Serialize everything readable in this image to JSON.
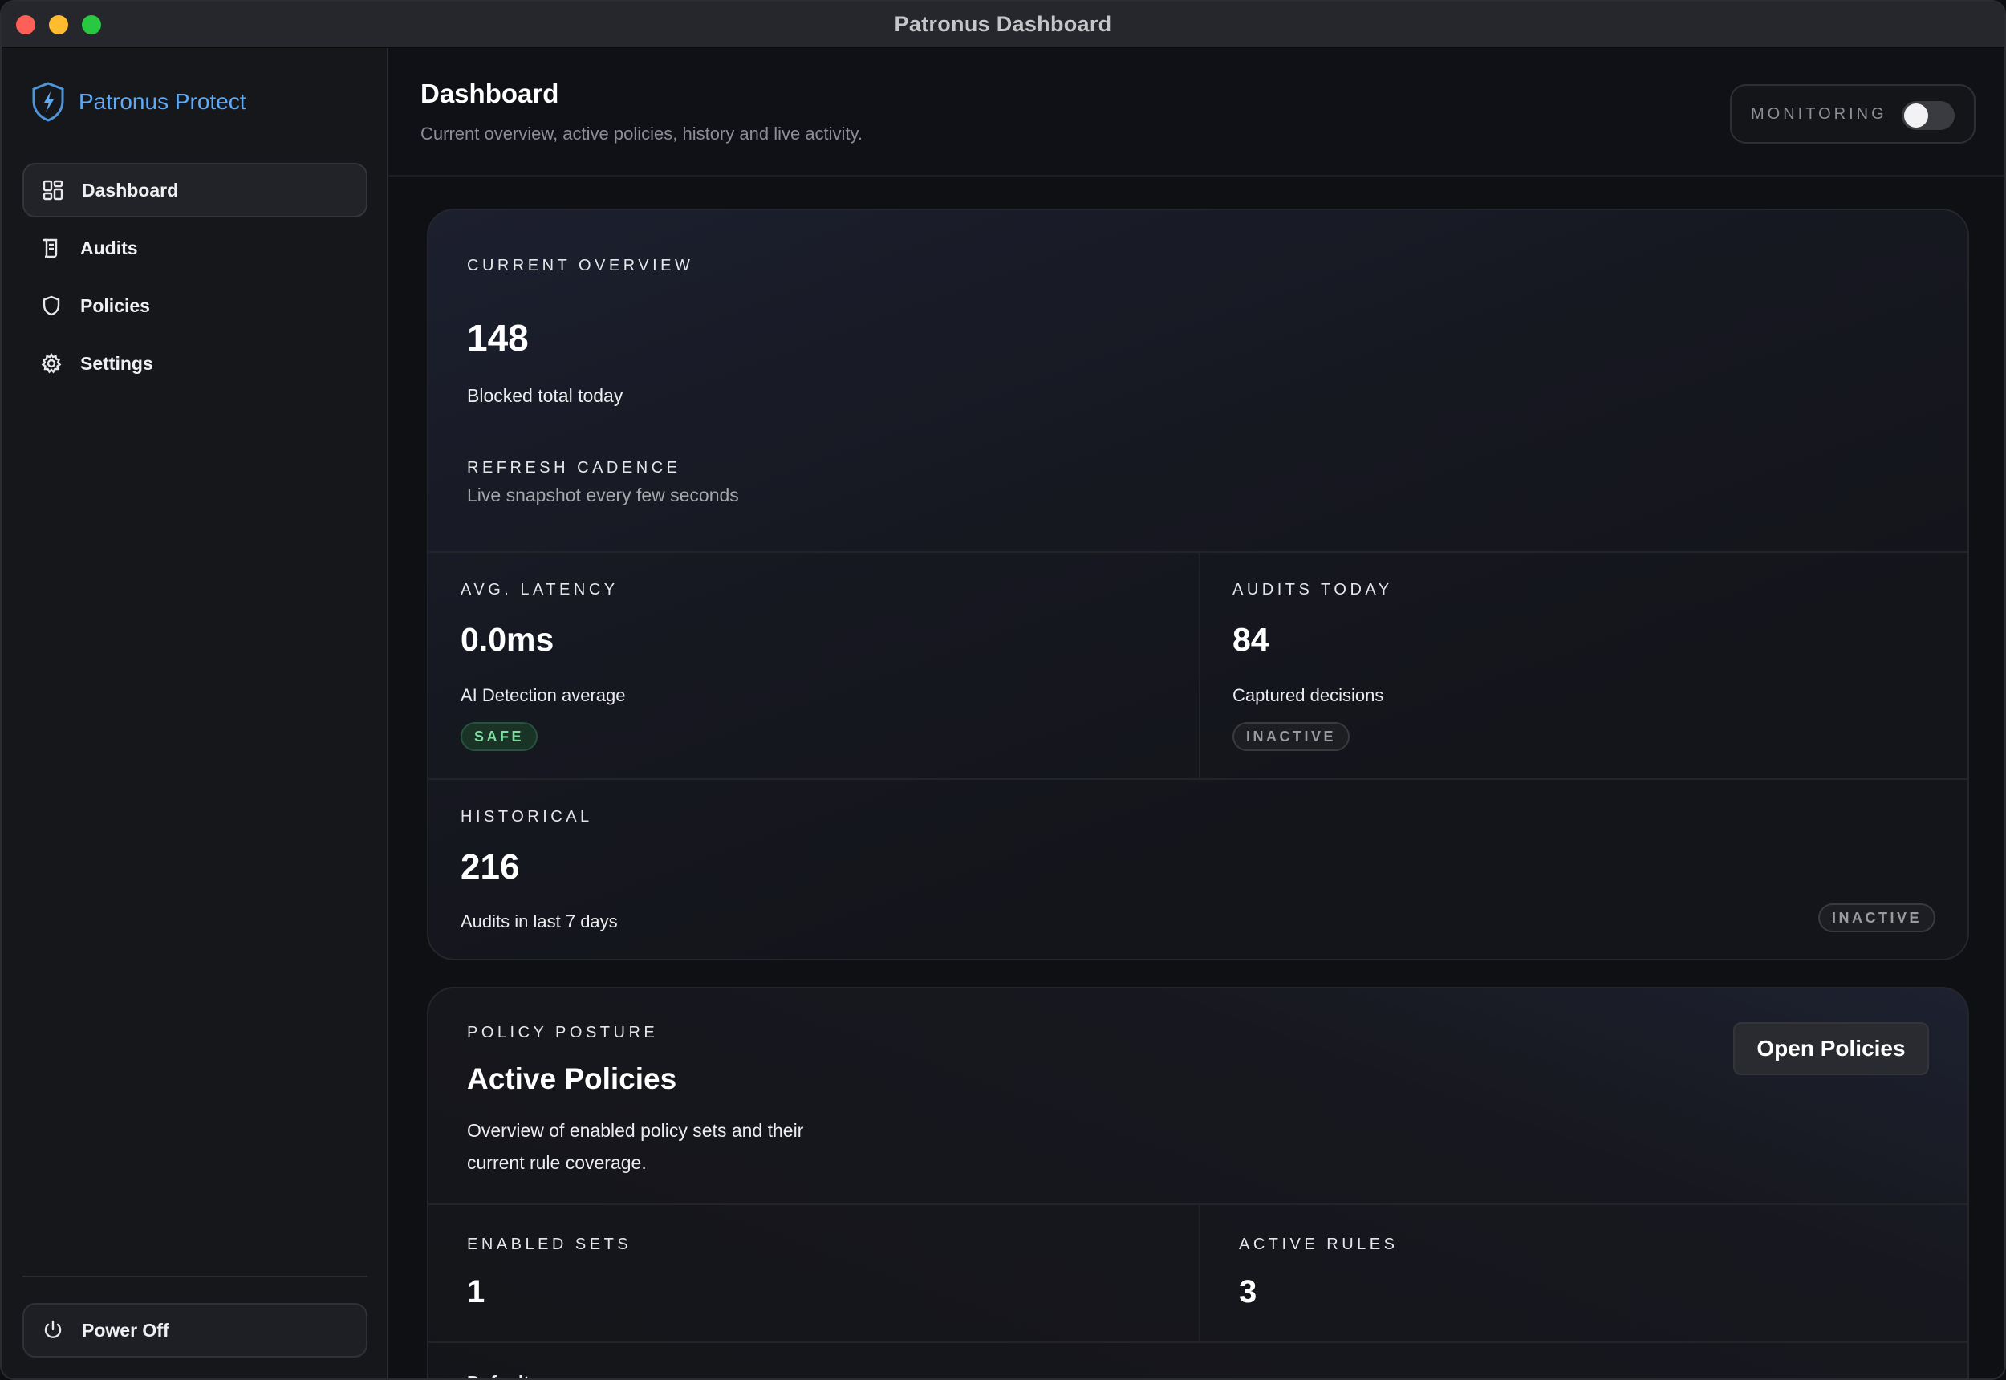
{
  "window": {
    "title": "Patronus Dashboard"
  },
  "sidebar": {
    "brand": "Patronus Protect",
    "items": [
      {
        "label": "Dashboard",
        "icon": "grid-icon",
        "active": true
      },
      {
        "label": "Audits",
        "icon": "scroll-icon",
        "active": false
      },
      {
        "label": "Policies",
        "icon": "shield-icon",
        "active": false
      },
      {
        "label": "Settings",
        "icon": "gear-icon",
        "active": false
      }
    ],
    "power_label": "Power Off"
  },
  "header": {
    "title": "Dashboard",
    "subtitle": "Current overview, active policies, history and live activity.",
    "monitoring_label": "MONITORING",
    "monitoring_on": false
  },
  "overview": {
    "eyebrow": "CURRENT OVERVIEW",
    "blocked_value": "148",
    "blocked_label": "Blocked total today",
    "refresh_eyebrow": "REFRESH CADENCE",
    "refresh_text": "Live snapshot every few seconds",
    "latency": {
      "eyebrow": "AVG. LATENCY",
      "value": "0.0ms",
      "label": "AI Detection average",
      "badge": "SAFE"
    },
    "audits_today": {
      "eyebrow": "AUDITS TODAY",
      "value": "84",
      "label": "Captured decisions",
      "badge": "INACTIVE"
    },
    "historical": {
      "eyebrow": "HISTORICAL",
      "value": "216",
      "label": "Audits in last 7 days",
      "badge": "INACTIVE"
    }
  },
  "policy": {
    "eyebrow": "POLICY POSTURE",
    "title": "Active Policies",
    "description_line1": "Overview of enabled policy sets and their",
    "description_line2": "current rule coverage.",
    "open_button": "Open Policies",
    "enabled_sets": {
      "eyebrow": "ENABLED SETS",
      "value": "1"
    },
    "active_rules": {
      "eyebrow": "ACTIVE RULES",
      "value": "3"
    },
    "next_row_label": "Default"
  },
  "colors": {
    "brand": "#5eaaf5",
    "safe": "#7ddc9e",
    "inactive": "#9a9ba1",
    "traffic_close": "#fe5f57",
    "traffic_min": "#febc2e",
    "traffic_max": "#28c840"
  }
}
